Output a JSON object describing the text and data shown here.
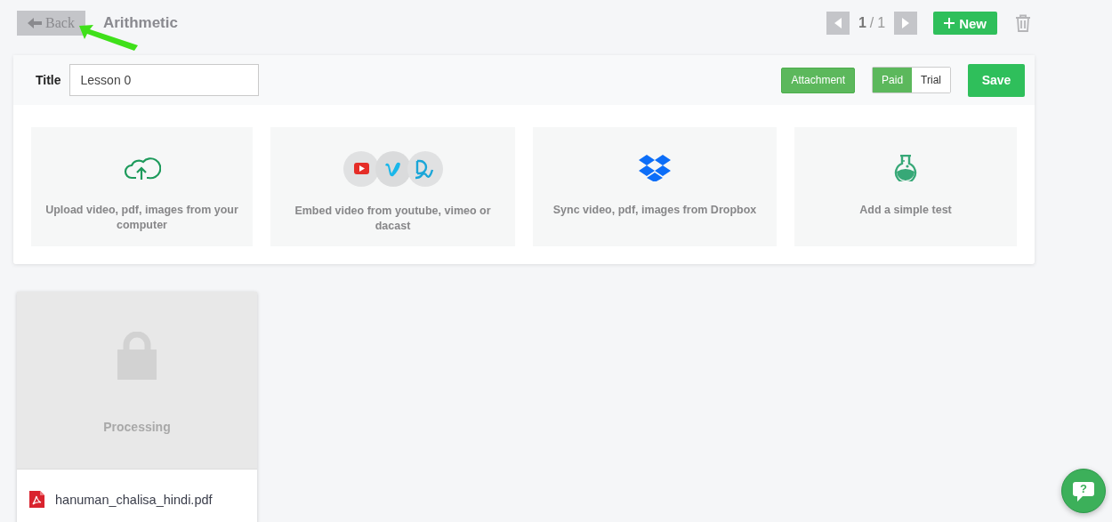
{
  "header": {
    "back_button": "Back",
    "title": "Arithmetic",
    "pager": {
      "current": "1",
      "separator": "/",
      "total": "1"
    },
    "new_button": "New"
  },
  "lesson": {
    "title_label": "Title",
    "title_value": "Lesson 0",
    "attachment_button": "Attachment",
    "access_options": [
      {
        "label": "Paid",
        "selected": true
      },
      {
        "label": "Trial",
        "selected": false
      }
    ],
    "save_button": "Save"
  },
  "sources": [
    {
      "kind": "upload",
      "label": "Upload video, pdf, images from your computer"
    },
    {
      "kind": "embed",
      "label": "Embed video from youtube, vimeo or dacast"
    },
    {
      "kind": "dropbox",
      "label": "Sync video, pdf, images from Dropbox"
    },
    {
      "kind": "test",
      "label": "Add a simple test"
    }
  ],
  "files": [
    {
      "kind": "pdf",
      "status": "Processing",
      "name": "hanuman_chalisa_hindi.pdf"
    }
  ],
  "help_button": "?"
}
